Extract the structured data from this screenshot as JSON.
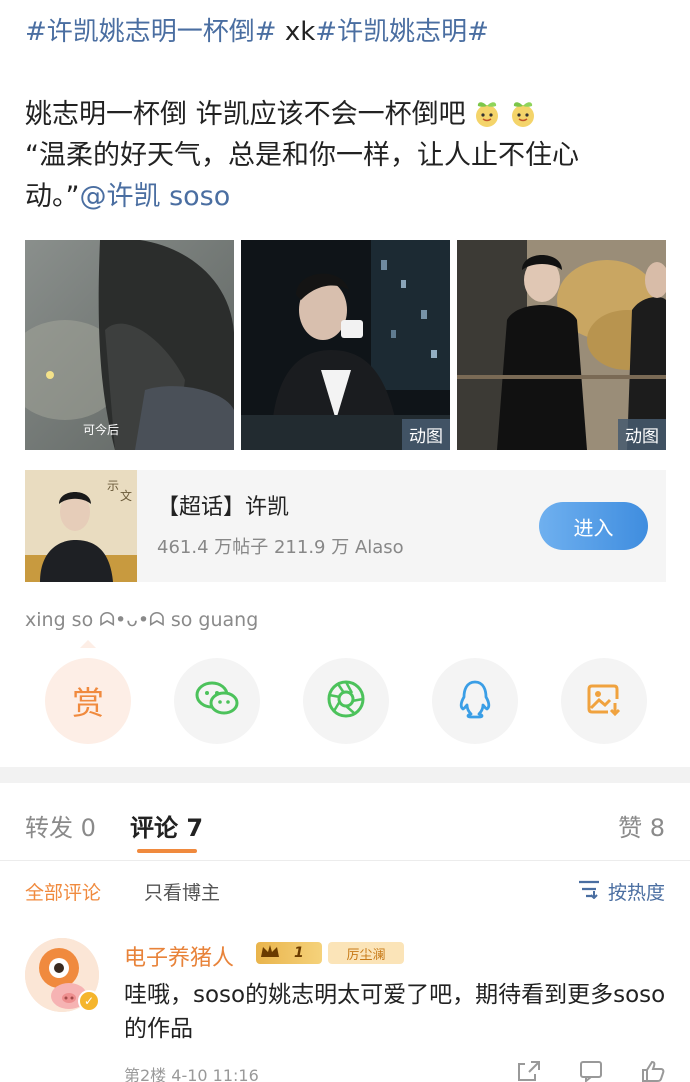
{
  "post": {
    "hashtag1": "#许凯姚志明一杯倒#",
    "hashtag_mid": " xk",
    "hashtag2": "#许凯姚志明#",
    "line1": "姚志明一杯倒 许凯应该不会一杯倒吧",
    "line2": "“温柔的好天气，总是和你一样，让人止不住心",
    "line3_text": "动。”",
    "mention": "@许凯 soso",
    "image_watermark": "可今后",
    "gif_label": "动图"
  },
  "topic": {
    "title": "【超话】许凯",
    "stats": "461.4 万帖子 211.9 万 Alaso",
    "enter_label": "进入"
  },
  "signature": "xing so ᗣ•ᴗ•ᗣ so guang",
  "share": {
    "reward_label": "赏"
  },
  "tabs": {
    "repost": "转发 0",
    "comments": "评论 7",
    "likes": "赞 8"
  },
  "filter": {
    "all": "全部评论",
    "author_only": "只看博主",
    "sort": "按热度"
  },
  "comment": {
    "name": "电子养猪人",
    "level": "1",
    "fans_badge": "厉尘澜",
    "text": "哇哦，soso的姚志明太可爱了吧，期待看到更多soso的作品",
    "meta": "第2楼 4-10 11:16"
  },
  "colors": {
    "accent": "#f08a3e",
    "link": "#4a6ea1",
    "button": "#3f8ddf"
  }
}
